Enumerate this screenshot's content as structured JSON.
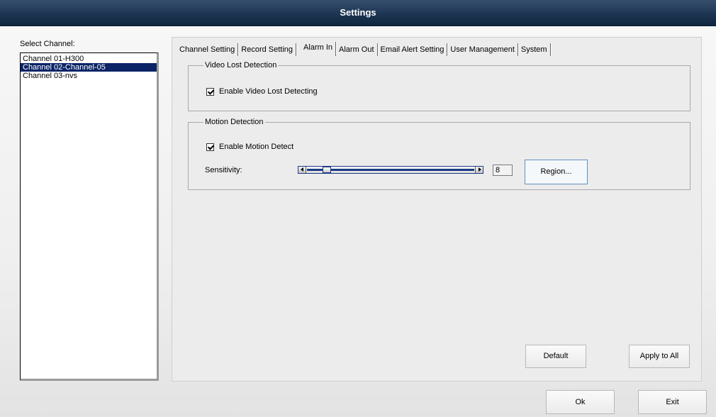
{
  "window": {
    "title": "Settings"
  },
  "channels": {
    "label": "Select Channel:",
    "items": [
      "Channel 01-H300",
      "Channel 02-Channel-05",
      "Channel 03-nvs"
    ],
    "selected_index": 1
  },
  "tabs": [
    {
      "label": "Channel Setting"
    },
    {
      "label": "Record Setting"
    },
    {
      "label": "Alarm In",
      "active": true
    },
    {
      "label": "Alarm Out"
    },
    {
      "label": "Email Alert Setting"
    },
    {
      "label": "User Management"
    },
    {
      "label": "System"
    }
  ],
  "video_lost": {
    "legend": "Video Lost Detection",
    "enable_label": "Enable Video Lost Detecting",
    "enabled": true
  },
  "motion": {
    "legend": "Motion Detection",
    "enable_label": "Enable Motion Detect",
    "enabled": true,
    "sensitivity_label": "Sensitivity:",
    "sensitivity_value": "8",
    "sensitivity_fraction": 0.1,
    "region_button": "Region..."
  },
  "buttons": {
    "default": "Default",
    "apply_all": "Apply to All",
    "ok": "Ok",
    "exit": "Exit"
  }
}
